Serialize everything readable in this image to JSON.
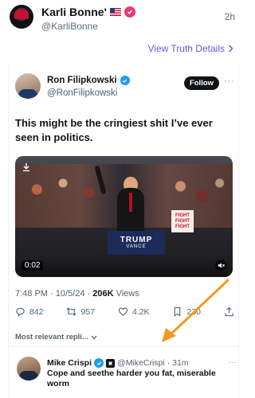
{
  "truth": {
    "display_name": "Karli Bonne'",
    "handle": "@KarliBonne",
    "time": "2h",
    "view_details": "View Truth Details",
    "verified_color": "#e83a73"
  },
  "tweet": {
    "author": "Ron Filipkowski",
    "handle": "@RonFilipkowski",
    "follow_label": "Follow",
    "more": "···",
    "text": "This might be the cringiest shit I’ve ever seen in politics.",
    "video": {
      "duration": "0:02",
      "podium_line1": "TRUMP",
      "podium_line2": "VANCE",
      "sign_text": "FIGHT FIGHT FIGHT"
    },
    "timestamp": "7:48 PM · 10/5/24 · ",
    "views_count": "206K",
    "views_label": " Views",
    "actions": {
      "replies": "842",
      "reposts": "957",
      "likes": "4.2K",
      "bookmarks": "230"
    },
    "sort_label": "Most relevant repli...",
    "accent_color": "#1d9bf0"
  },
  "reply": {
    "author": "Mike Crispi",
    "handle": "@MikeCrispi",
    "time": " · 31m",
    "text": "Cope and seethe harder you fat, miserable worm",
    "more": "···"
  },
  "annotation": {
    "arrow_color": "#f39a1e"
  }
}
